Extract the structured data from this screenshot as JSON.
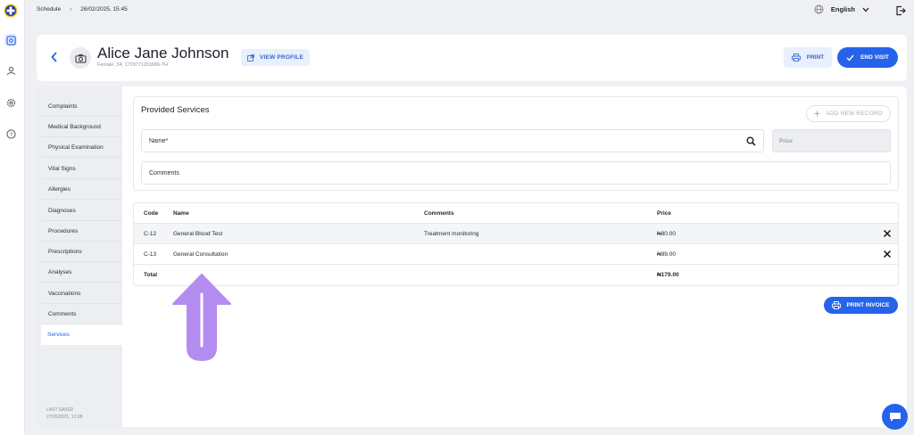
{
  "topbar": {
    "breadcrumb": [
      "Schedule",
      "26/02/2025, 15:45"
    ],
    "breadcrumb_sep": "›",
    "language": "English"
  },
  "patient": {
    "name": "Alice Jane Johnson",
    "meta": "Female, 34, 1729771153686-TH",
    "view_profile": "VIEW PROFILE"
  },
  "actions": {
    "print": "PRINT",
    "end_visit": "END VISIT"
  },
  "sidebar": {
    "items": [
      {
        "label": "Complaints"
      },
      {
        "label": "Medical Background"
      },
      {
        "label": "Physical Examination"
      },
      {
        "label": "Vital Signs"
      },
      {
        "label": "Allergies"
      },
      {
        "label": "Diagnoses"
      },
      {
        "label": "Procedures"
      },
      {
        "label": "Prescriptions"
      },
      {
        "label": "Analyses"
      },
      {
        "label": "Vaccinations"
      },
      {
        "label": "Comments"
      },
      {
        "label": "Services",
        "active": true
      }
    ],
    "last_saved_label": "LAST SAVED",
    "last_saved_value": "27/05/2025, 12:08"
  },
  "services_form": {
    "title": "Provided Services",
    "add_new_record": "ADD NEW RECORD",
    "name_placeholder": "Name*",
    "price_placeholder": "Price",
    "comments_placeholder": "Comments"
  },
  "services_table": {
    "headers": {
      "code": "Code",
      "name": "Name",
      "comments": "Comments",
      "price": "Price"
    },
    "rows": [
      {
        "code": "C-12",
        "name": "General Blood Test",
        "comments": "Treatment monitoring",
        "price": "₦80.00"
      },
      {
        "code": "C-13",
        "name": "General Consultation",
        "comments": "",
        "price": "₦99.00"
      }
    ],
    "total_label": "Total",
    "total_value": "₦179.00"
  },
  "print_invoice": "PRINT INVOICE",
  "colors": {
    "accent": "#2563eb",
    "arrow": "#b48cf0"
  }
}
